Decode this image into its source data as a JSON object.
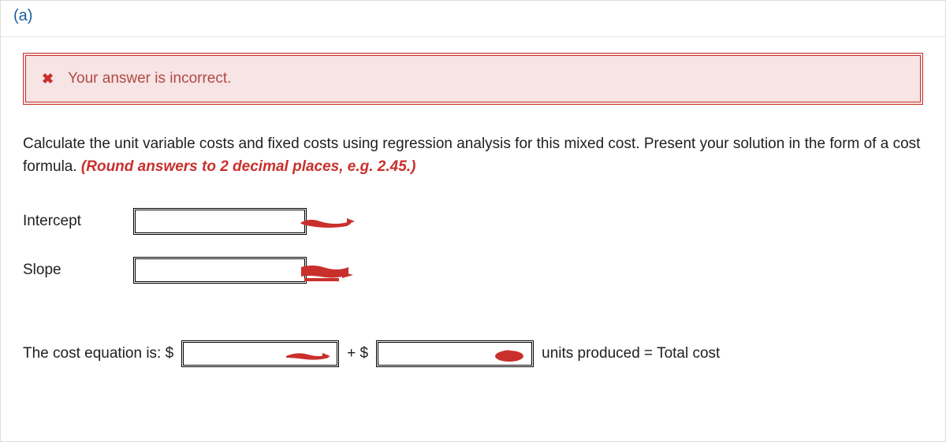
{
  "part_label": "(a)",
  "feedback": {
    "icon": "x",
    "text": "Your answer is incorrect."
  },
  "question": {
    "prompt": "Calculate the unit variable costs and fixed costs using regression analysis for this mixed cost. Present your solution in the form of a cost formula. ",
    "round_note": "(Round answers to 2 decimal places, e.g. 2.45.)"
  },
  "fields": {
    "intercept_label": "Intercept",
    "intercept_value": "",
    "slope_label": "Slope",
    "slope_value": ""
  },
  "equation": {
    "prefix": "The cost equation is: $",
    "value1": "",
    "plus": "+ $",
    "value2": "",
    "suffix": "units produced = Total cost"
  }
}
